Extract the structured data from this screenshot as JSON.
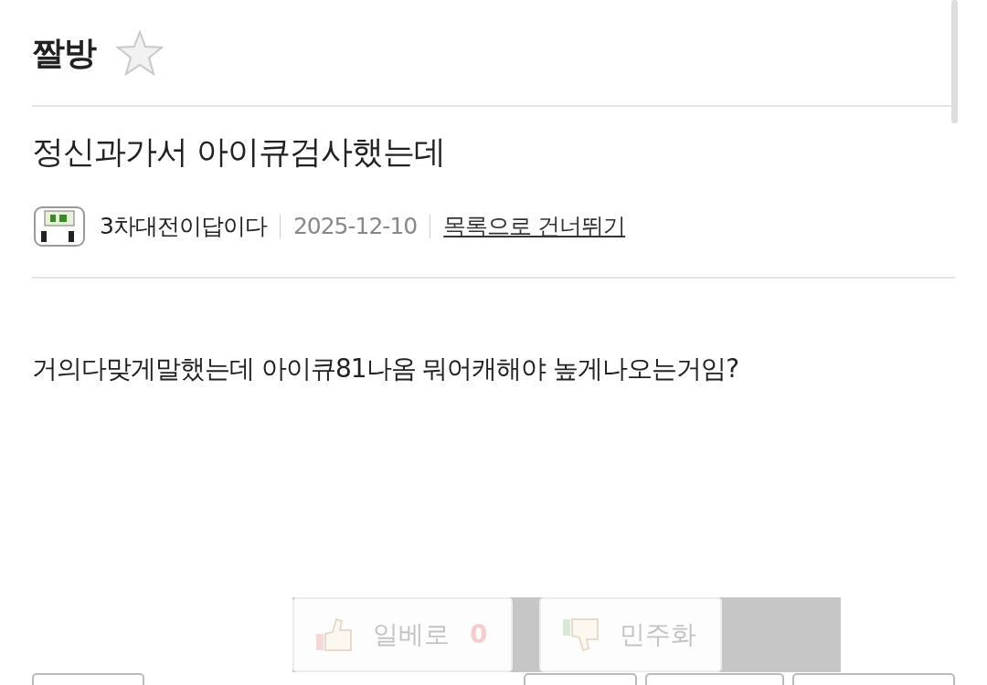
{
  "board": {
    "title": "짤방",
    "favorite": false
  },
  "post": {
    "title": "정신과가서 아이큐검사했는데",
    "author": "3차대전이답이다",
    "date": "2025-12-10",
    "skip_link": "목록으로 건너뛰기",
    "body": "거의다맞게말했는데 아이큐81나옴 뭐어캐해야 높게나오는거임?"
  },
  "votes": [
    {
      "kind": "up",
      "label": "일베로",
      "count": "0"
    },
    {
      "kind": "down",
      "label": "민주화"
    }
  ]
}
